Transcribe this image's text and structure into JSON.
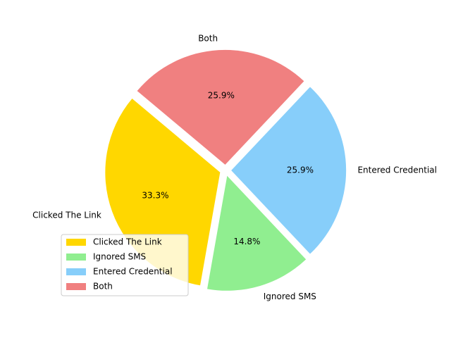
{
  "chart_data": {
    "type": "pie",
    "categories": [
      "Clicked The Link",
      "Ignored SMS",
      "Entered Credential",
      "Both"
    ],
    "values": [
      33.3,
      14.8,
      25.9,
      25.9
    ],
    "value_labels": [
      "33.3%",
      "14.8%",
      "25.9%",
      "25.9%"
    ],
    "colors": [
      "#FFD700",
      "#90EE90",
      "#87CEFA",
      "#F08080"
    ],
    "start_angle_deg": 140,
    "explode": 0.05,
    "legend": {
      "placement": "lower-left",
      "entries": [
        "Clicked The Link",
        "Ignored SMS",
        "Entered Credential",
        "Both"
      ]
    }
  }
}
